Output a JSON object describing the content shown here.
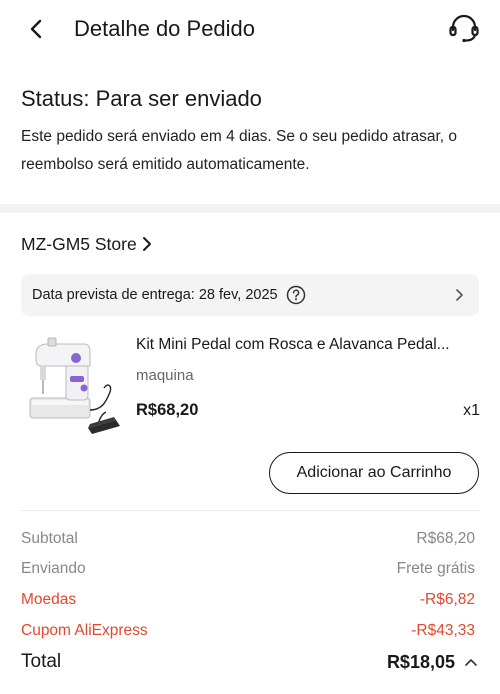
{
  "header": {
    "title": "Detalhe do Pedido"
  },
  "status": {
    "title": "Status: Para ser enviado",
    "description": "Este pedido será enviado em 4 dias. Se o seu pedido atrasar, o reembolso será emitido automaticamente."
  },
  "store": {
    "name": "MZ-GM5 Store"
  },
  "delivery": {
    "text": "Data prevista de entrega: 28 fev, 2025"
  },
  "product": {
    "title": "Kit Mini Pedal com Rosca e Alavanca Pedal...",
    "variant": "maquina",
    "price": "R$68,20",
    "quantity": "x1",
    "add_to_cart_label": "Adicionar ao Carrinho"
  },
  "summary": {
    "subtotal_label": "Subtotal",
    "subtotal_value": "R$68,20",
    "shipping_label": "Enviando",
    "shipping_value": "Frete grátis",
    "coins_label": "Moedas",
    "coins_value": "-R$6,82",
    "coupon_label": "Cupom AliExpress",
    "coupon_value": "-R$43,33",
    "total_label": "Total",
    "total_value": "R$18,05"
  },
  "colors": {
    "discount_red": "#e0492f",
    "text_gray": "#888888",
    "accent_purple": "#8a63d2"
  }
}
